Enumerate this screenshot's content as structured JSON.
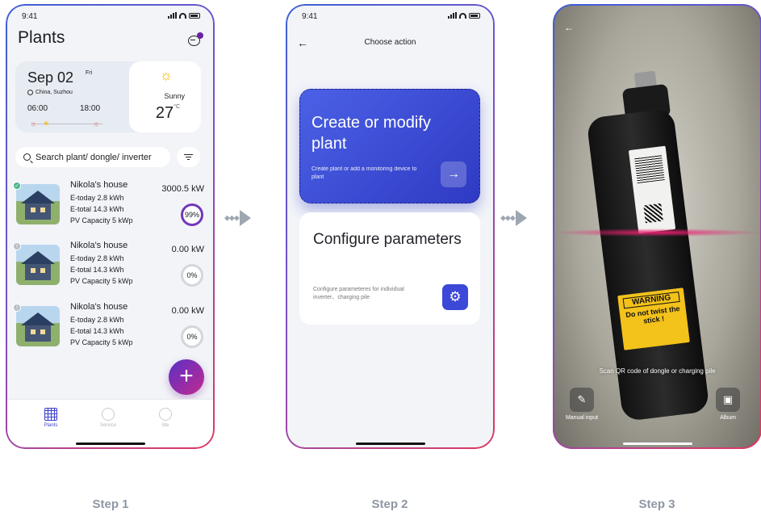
{
  "screens": {
    "plants": {
      "status_time": "9:41",
      "title": "Plants",
      "weather": {
        "date": "Sep 02",
        "weekday": "Fri",
        "location": "China, Suzhou",
        "sunrise": "06:00",
        "sunset": "18:00",
        "condition": "Sunny",
        "temperature": "27",
        "temp_unit": "°C"
      },
      "search_placeholder": "Search plant/ dongle/ inverter",
      "plants": [
        {
          "name": "Nikola's house",
          "etoday": "E-today 2.8 kWh",
          "etotal": "E-total 14.3 kWh",
          "capacity": "PV Capacity  5 kWp",
          "power": "3000.5 kW",
          "percent": "99%",
          "status": "online"
        },
        {
          "name": "Nikola's house",
          "etoday": "E-today 2.8 kWh",
          "etotal": "E-total 14.3 kWh",
          "capacity": "PV Capacity  5 kWp",
          "power": "0.00 kW",
          "percent": "0%",
          "status": "offline"
        },
        {
          "name": "Nikola's house",
          "etoday": "E-today 2.8 kWh",
          "etotal": "E-total 14.3 kWh",
          "capacity": "PV Capacity  5 kWp",
          "power": "0.00 kW",
          "percent": "0%",
          "status": "offline"
        }
      ],
      "add_label": "+",
      "tabs": {
        "plants": "Plants",
        "service": "Service",
        "me": "Me"
      }
    },
    "choose_action": {
      "status_time": "9:41",
      "back_icon": "←",
      "title": "Choose action",
      "create": {
        "heading": "Create or modify plant",
        "description": "Create plant or add a monitoring device to plant",
        "arrow": "→"
      },
      "configure": {
        "heading": "Configure parameters",
        "description": "Configure parameteres for individual inverter、charging pile",
        "icon": "⚙"
      }
    },
    "scan": {
      "back_icon": "←",
      "hint": "Scan QR code of dongle or charging pile",
      "manual_input": "Manual input",
      "album": "Album",
      "warning_title": "WARNING",
      "warning_text": "Do not twist the stick !"
    }
  },
  "steps": [
    "Step 1",
    "Step 2",
    "Step 3"
  ],
  "colors": {
    "accent": "#3b3fc9",
    "card_blue": "#3c48d7",
    "scan_line": "#e92070",
    "fab_start": "#5a2fc6",
    "fab_end": "#c22a8e",
    "online": "#4bb38a",
    "offline": "#b9bdc5"
  }
}
